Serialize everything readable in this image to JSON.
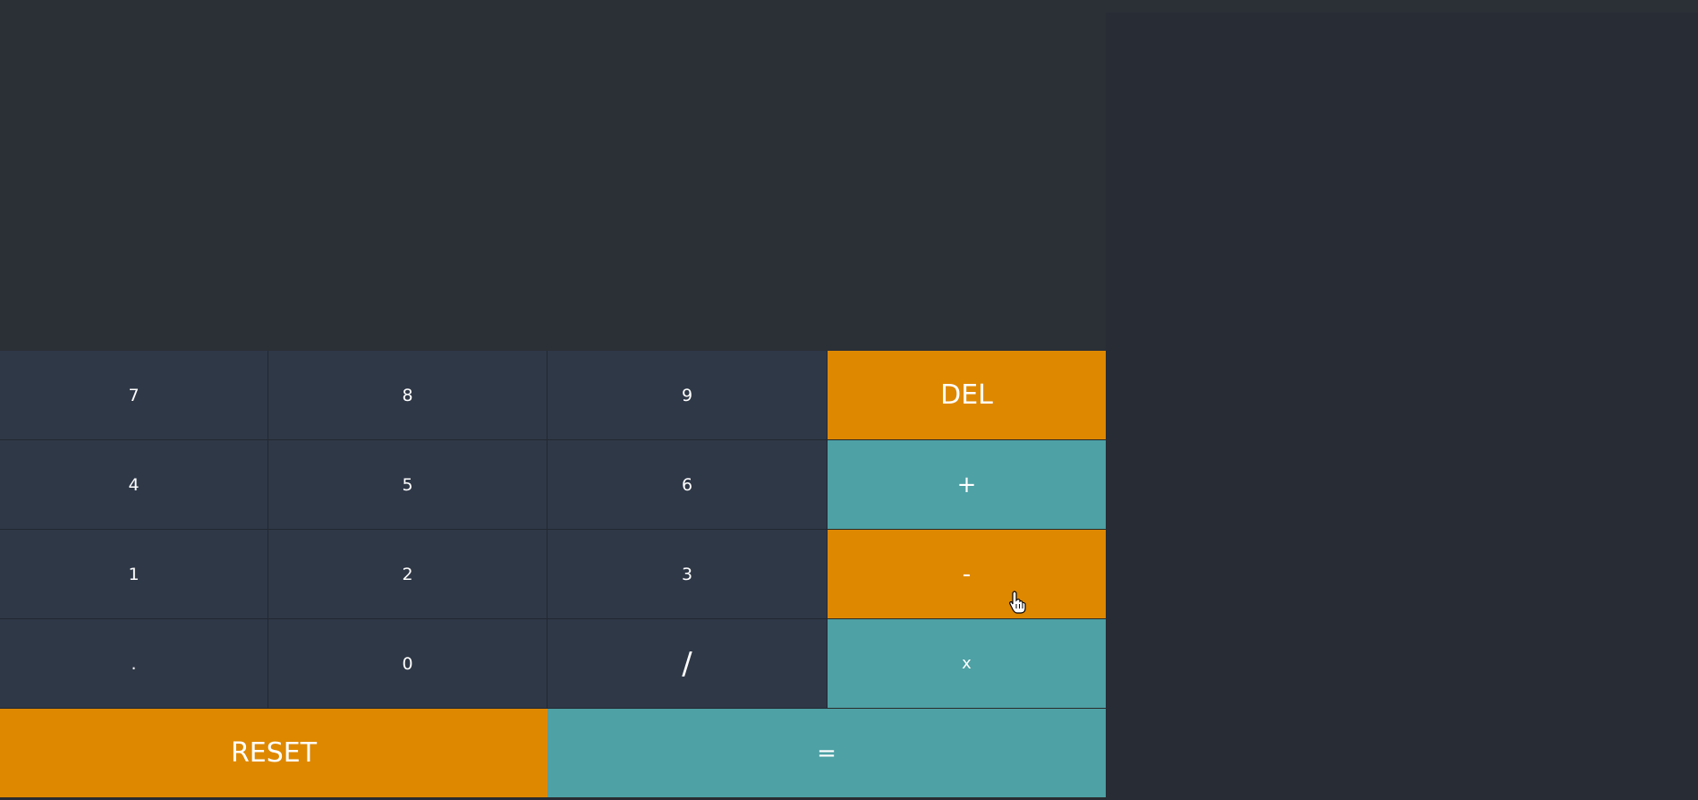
{
  "display": {
    "value": ""
  },
  "keys": {
    "seven": "7",
    "eight": "8",
    "nine": "9",
    "del": "DEL",
    "four": "4",
    "five": "5",
    "six": "6",
    "plus": "+",
    "one": "1",
    "two": "2",
    "three": "3",
    "minus": "-",
    "dot": ".",
    "zero": "0",
    "divide": "/",
    "multiply": "x",
    "reset": "RESET",
    "equals": "="
  },
  "colors": {
    "background": "#282c35",
    "number_key": "#2f3847",
    "accent_orange": "#de8800",
    "accent_teal": "#4ea1a5",
    "text": "#ffffff"
  },
  "icons": {
    "cursor": "hand-pointer-icon"
  }
}
